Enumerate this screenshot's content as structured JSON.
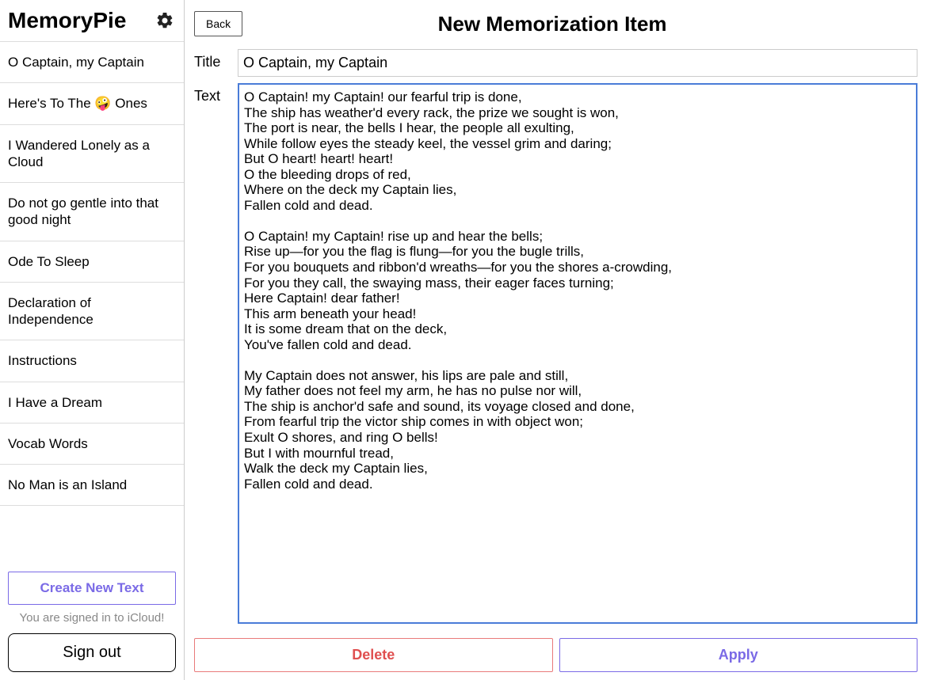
{
  "app": {
    "title": "MemoryPie"
  },
  "sidebar": {
    "items": [
      {
        "label": "O Captain, my Captain"
      },
      {
        "label": "Here's To The 🤪 Ones"
      },
      {
        "label": "I Wandered Lonely as a Cloud"
      },
      {
        "label": "Do not go gentle into that good night"
      },
      {
        "label": "Ode To Sleep"
      },
      {
        "label": "Declaration of Independence"
      },
      {
        "label": "Instructions"
      },
      {
        "label": "I Have a Dream"
      },
      {
        "label": "Vocab Words"
      },
      {
        "label": "No Man is an Island"
      }
    ],
    "create_label": "Create New Text",
    "icloud_status": "You are signed in to iCloud!",
    "signout_label": "Sign out"
  },
  "editor": {
    "back_label": "Back",
    "page_title": "New Memorization Item",
    "title_label": "Title",
    "text_label": "Text",
    "title_value": "O Captain, my Captain",
    "text_value": "O Captain! my Captain! our fearful trip is done,\nThe ship has weather'd every rack, the prize we sought is won,\nThe port is near, the bells I hear, the people all exulting,\nWhile follow eyes the steady keel, the vessel grim and daring;\nBut O heart! heart! heart!\nO the bleeding drops of red,\nWhere on the deck my Captain lies,\nFallen cold and dead.\n\nO Captain! my Captain! rise up and hear the bells;\nRise up—for you the flag is flung—for you the bugle trills,\nFor you bouquets and ribbon'd wreaths—for you the shores a-crowding,\nFor you they call, the swaying mass, their eager faces turning;\nHere Captain! dear father!\nThis arm beneath your head!\nIt is some dream that on the deck,\nYou've fallen cold and dead.\n\nMy Captain does not answer, his lips are pale and still,\nMy father does not feel my arm, he has no pulse nor will,\nThe ship is anchor'd safe and sound, its voyage closed and done,\nFrom fearful trip the victor ship comes in with object won;\nExult O shores, and ring O bells!\nBut I with mournful tread,\nWalk the deck my Captain lies,\nFallen cold and dead.",
    "delete_label": "Delete",
    "apply_label": "Apply"
  }
}
